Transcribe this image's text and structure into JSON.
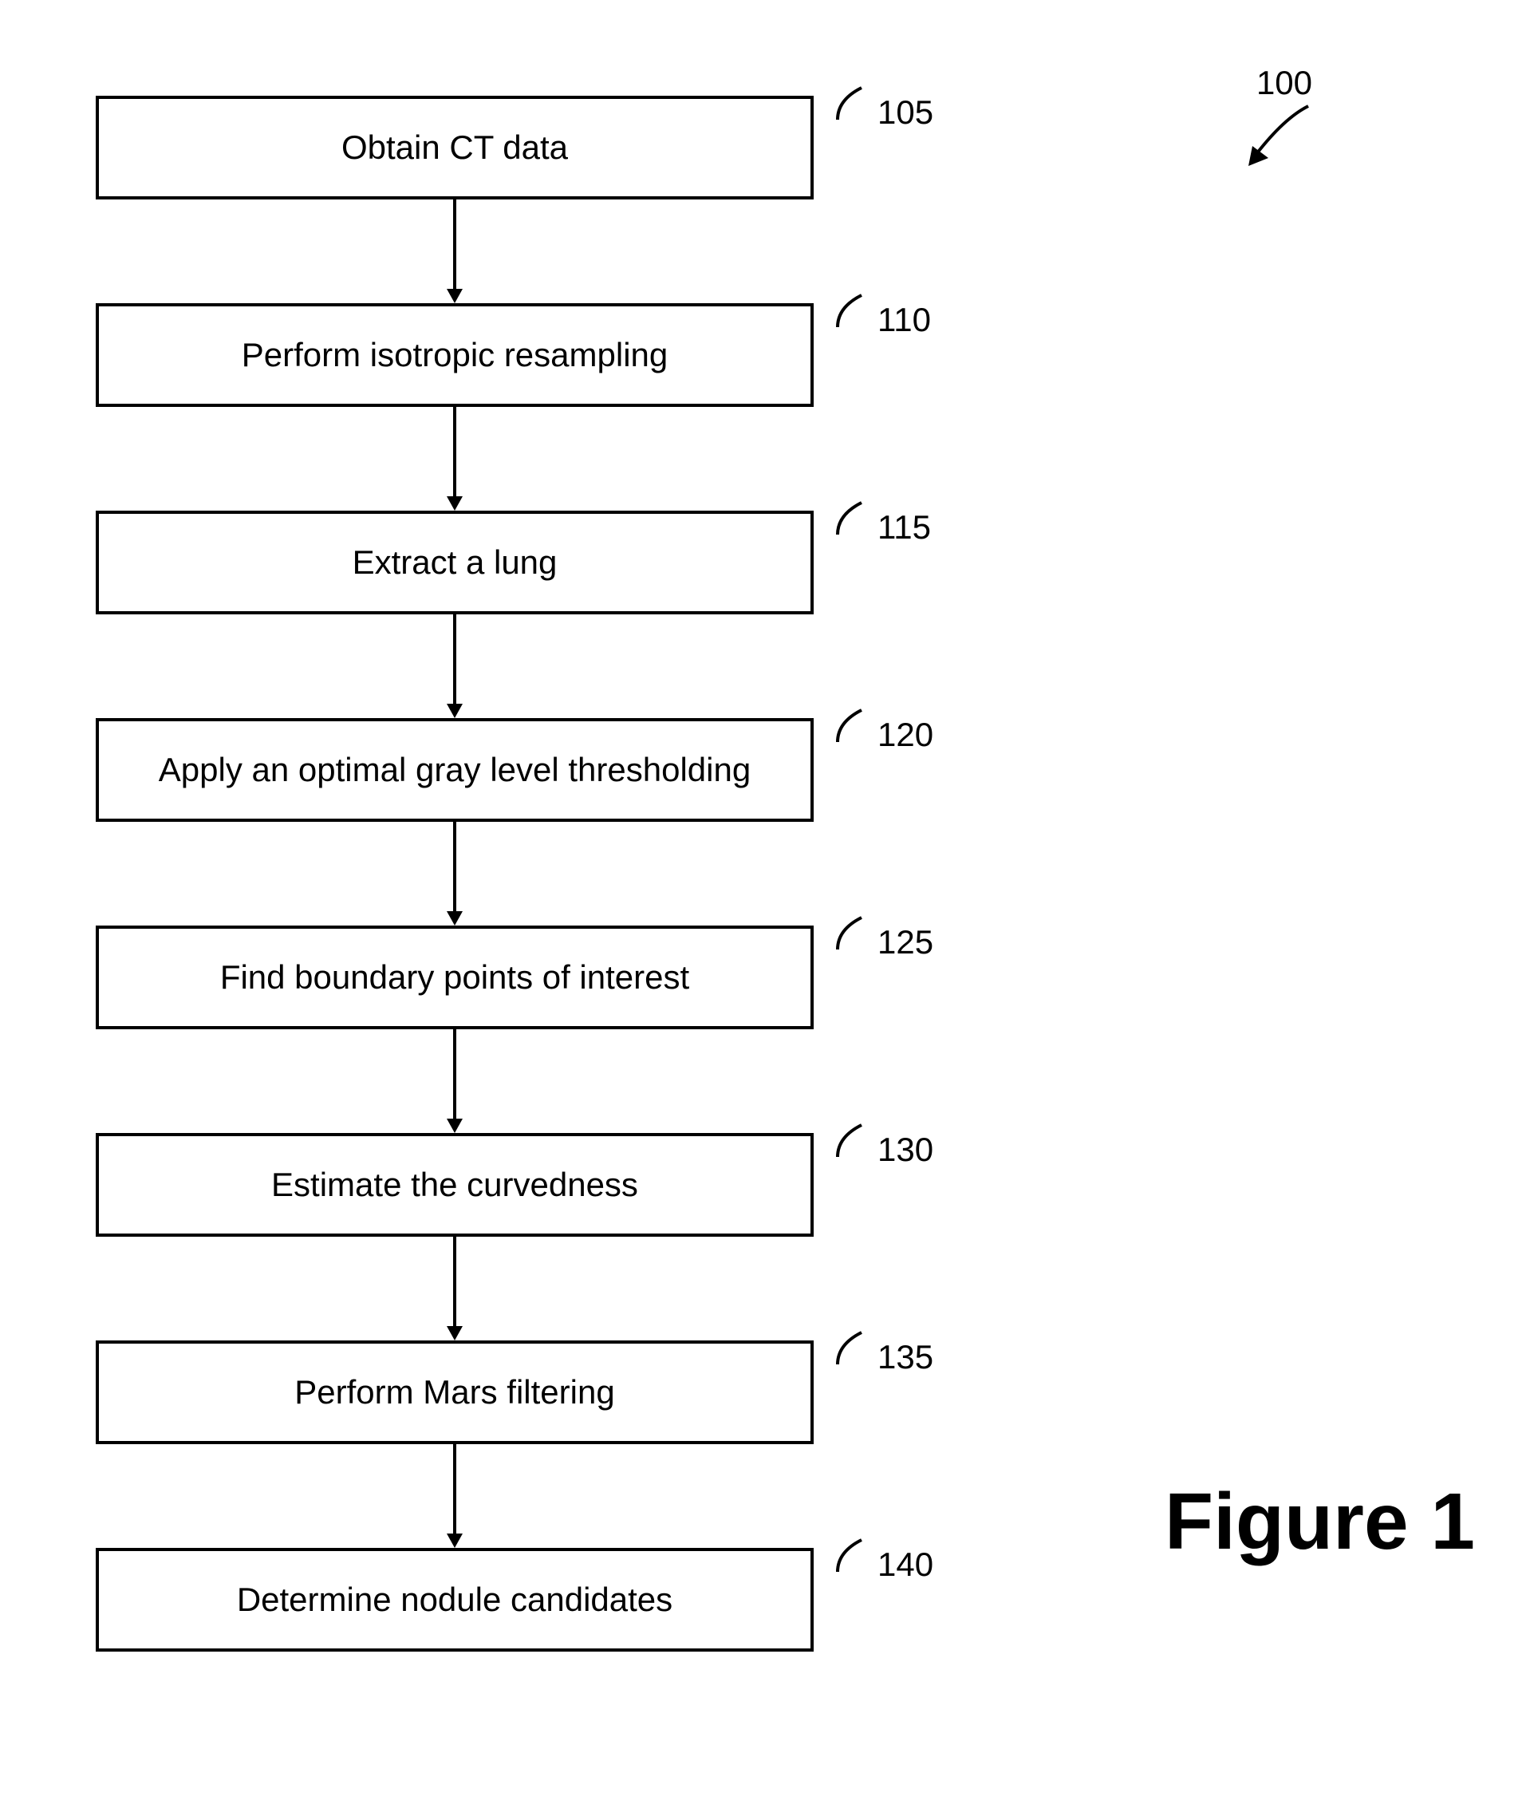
{
  "flowchart": {
    "reference_number": "100",
    "steps": [
      {
        "label": "Obtain CT data",
        "ref": "105"
      },
      {
        "label": "Perform isotropic resampling",
        "ref": "110"
      },
      {
        "label": "Extract a lung",
        "ref": "115"
      },
      {
        "label": "Apply an optimal gray level thresholding",
        "ref": "120"
      },
      {
        "label": "Find boundary points of interest",
        "ref": "125"
      },
      {
        "label": "Estimate the curvedness",
        "ref": "130"
      },
      {
        "label": "Perform Mars filtering",
        "ref": "135"
      },
      {
        "label": "Determine nodule candidates",
        "ref": "140"
      }
    ]
  },
  "figure_label": "Figure 1"
}
